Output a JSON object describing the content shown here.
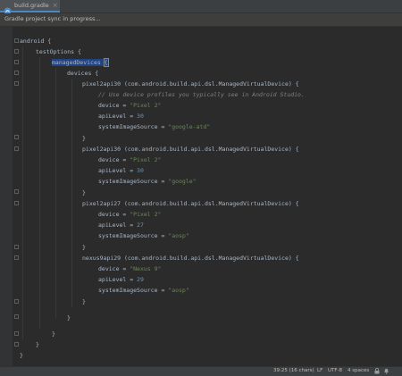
{
  "tab": {
    "icon": "gradle-file-icon",
    "label": "build.gradle",
    "close": "×"
  },
  "sync": {
    "message": "Gradle project sync in progress..."
  },
  "status": {
    "position": "39:25 (16 chars)",
    "line_separator": "LF",
    "encoding": "UTF-8",
    "indent": "4 spaces",
    "lock_icon": "lock-icon",
    "notifications_icon": "notifications-icon"
  },
  "code": {
    "l1": "android {",
    "l2": "testOptions {",
    "l3a": "managedDevices ",
    "l3b": "{",
    "l4": "devices {",
    "d1_name": "pixel2api30 (com.android.build.api.dsl.ManagedVirtualDevice) {",
    "d1_comment": "// Use device profiles you typically see in Android Studio.",
    "d1_device_key": "device = ",
    "d1_device_val": "\"Pixel 2\"",
    "d1_api_key": "apiLevel = ",
    "d1_api_val": "30",
    "d1_img_key": "systemImageSource = ",
    "d1_img_val": "\"google-atd\"",
    "close": "}",
    "d2_name": "pixel2api30 (com.android.build.api.dsl.ManagedVirtualDevice) {",
    "d2_device_key": "device = ",
    "d2_device_val": "\"Pixel 2\"",
    "d2_api_key": "apiLevel = ",
    "d2_api_val": "30",
    "d2_img_key": "systemImageSource = ",
    "d2_img_val": "\"google\"",
    "d3_name": "pixel2api27 (com.android.build.api.dsl.ManagedVirtualDevice) {",
    "d3_device_key": "device = ",
    "d3_device_val": "\"Pixel 2\"",
    "d3_api_key": "apiLevel = ",
    "d3_api_val": "27",
    "d3_img_key": "systemImageSource = ",
    "d3_img_val": "\"aosp\"",
    "d4_name": "nexus9api29 (com.android.build.api.dsl.ManagedVirtualDevice) {",
    "d4_device_key": "device = ",
    "d4_device_val": "\"Nexus 9\"",
    "d4_api_key": "apiLevel = ",
    "d4_api_val": "29",
    "d4_img_key": "systemImageSource = ",
    "d4_img_val": "\"aosp\""
  },
  "colors": {
    "keyword": "#a9b7c6",
    "number": "#6897bb",
    "string": "#6a8759",
    "comment": "#808080",
    "selection": "#214283"
  }
}
